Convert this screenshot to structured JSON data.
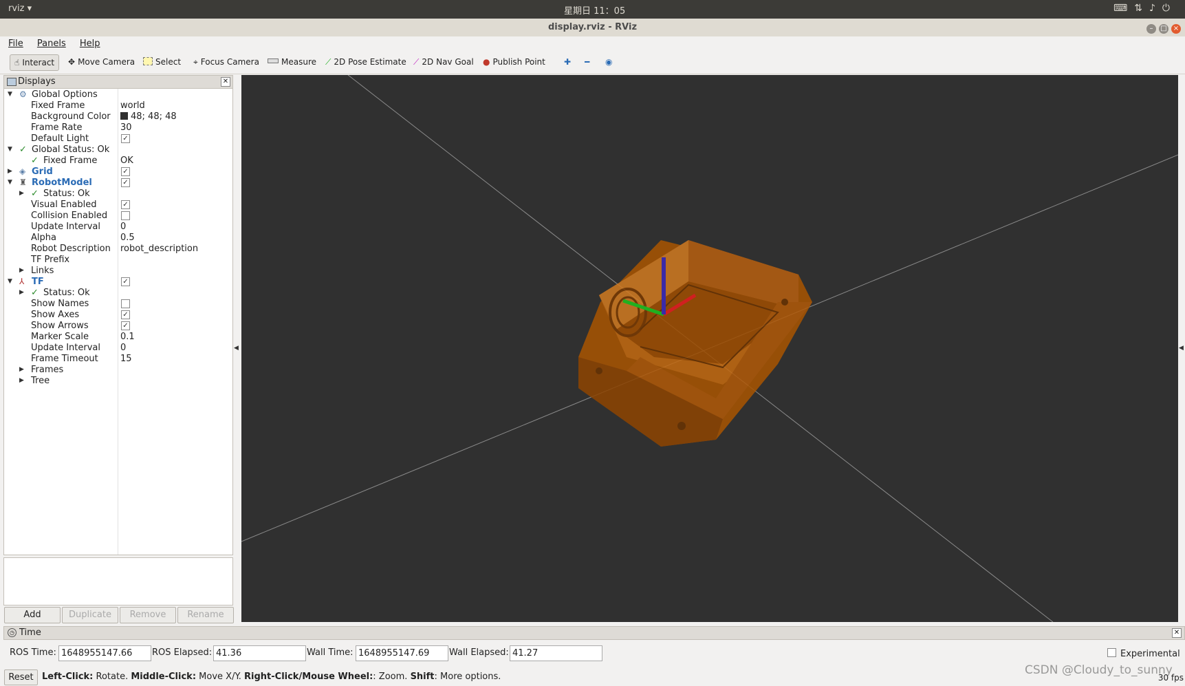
{
  "topbar": {
    "app_name": "rviz ▾",
    "clock": "星期日 11：05"
  },
  "window": {
    "title": "display.rviz - RViz"
  },
  "menu": [
    "File",
    "Panels",
    "Help"
  ],
  "toolbar": [
    {
      "label": "Interact",
      "icon": "hand-icon",
      "active": true
    },
    {
      "label": "Move Camera",
      "icon": "move-camera-icon"
    },
    {
      "label": "Select",
      "icon": "select-icon"
    },
    {
      "label": "Focus Camera",
      "icon": "focus-camera-icon"
    },
    {
      "label": "Measure",
      "icon": "ruler-icon"
    },
    {
      "label": "2D Pose Estimate",
      "icon": "green-arrow-icon"
    },
    {
      "label": "2D Nav Goal",
      "icon": "magenta-arrow-icon"
    },
    {
      "label": "Publish Point",
      "icon": "pin-icon"
    }
  ],
  "displays": {
    "title": "Displays",
    "rows": [
      {
        "label": "Global Options",
        "value": ""
      },
      {
        "label": "Fixed Frame",
        "value": "world"
      },
      {
        "label": "Background Color",
        "value": "48; 48; 48"
      },
      {
        "label": "Frame Rate",
        "value": "30"
      },
      {
        "label": "Default Light",
        "value": ""
      },
      {
        "label": "Global Status: Ok",
        "value": ""
      },
      {
        "label": "Fixed Frame",
        "value": "OK"
      },
      {
        "label": "Grid",
        "value": ""
      },
      {
        "label": "RobotModel",
        "value": ""
      },
      {
        "label": "Status: Ok",
        "value": ""
      },
      {
        "label": "Visual Enabled",
        "value": ""
      },
      {
        "label": "Collision Enabled",
        "value": ""
      },
      {
        "label": "Update Interval",
        "value": "0"
      },
      {
        "label": "Alpha",
        "value": "0.5"
      },
      {
        "label": "Robot Description",
        "value": "robot_description"
      },
      {
        "label": "TF Prefix",
        "value": ""
      },
      {
        "label": "Links",
        "value": ""
      },
      {
        "label": "TF",
        "value": ""
      },
      {
        "label": "Status: Ok",
        "value": ""
      },
      {
        "label": "Show Names",
        "value": ""
      },
      {
        "label": "Show Axes",
        "value": ""
      },
      {
        "label": "Show Arrows",
        "value": ""
      },
      {
        "label": "Marker Scale",
        "value": "0.1"
      },
      {
        "label": "Update Interval",
        "value": "0"
      },
      {
        "label": "Frame Timeout",
        "value": "15"
      },
      {
        "label": "Frames",
        "value": ""
      },
      {
        "label": "Tree",
        "value": ""
      }
    ],
    "buttons": [
      "Add",
      "Duplicate",
      "Remove",
      "Rename"
    ],
    "background_color": "#303030"
  },
  "time": {
    "title": "Time",
    "ros_time_label": "ROS Time:",
    "ros_time": "1648955147.66",
    "ros_elapsed_label": "ROS Elapsed:",
    "ros_elapsed": "41.36",
    "wall_time_label": "Wall Time:",
    "wall_time": "1648955147.69",
    "wall_elapsed_label": "Wall Elapsed:",
    "wall_elapsed": "41.27",
    "experimental_label": "Experimental"
  },
  "status": {
    "reset_label": "Reset",
    "hint_left": "Left-Click:",
    "hint_left_text": " Rotate. ",
    "hint_middle": "Middle-Click:",
    "hint_middle_text": " Move X/Y. ",
    "hint_right": "Right-Click/Mouse Wheel:",
    "hint_right_text": ": Zoom. ",
    "hint_shift": "Shift",
    "hint_shift_text": ": More options.",
    "fps": "30 fps"
  },
  "watermark": "CSDN @Cloudy_to_sunny",
  "colors": {
    "model": "#c46a10",
    "viewport": "#303030",
    "axis_x": "#d02020",
    "axis_y": "#20b020",
    "axis_z": "#3a2aa8"
  }
}
